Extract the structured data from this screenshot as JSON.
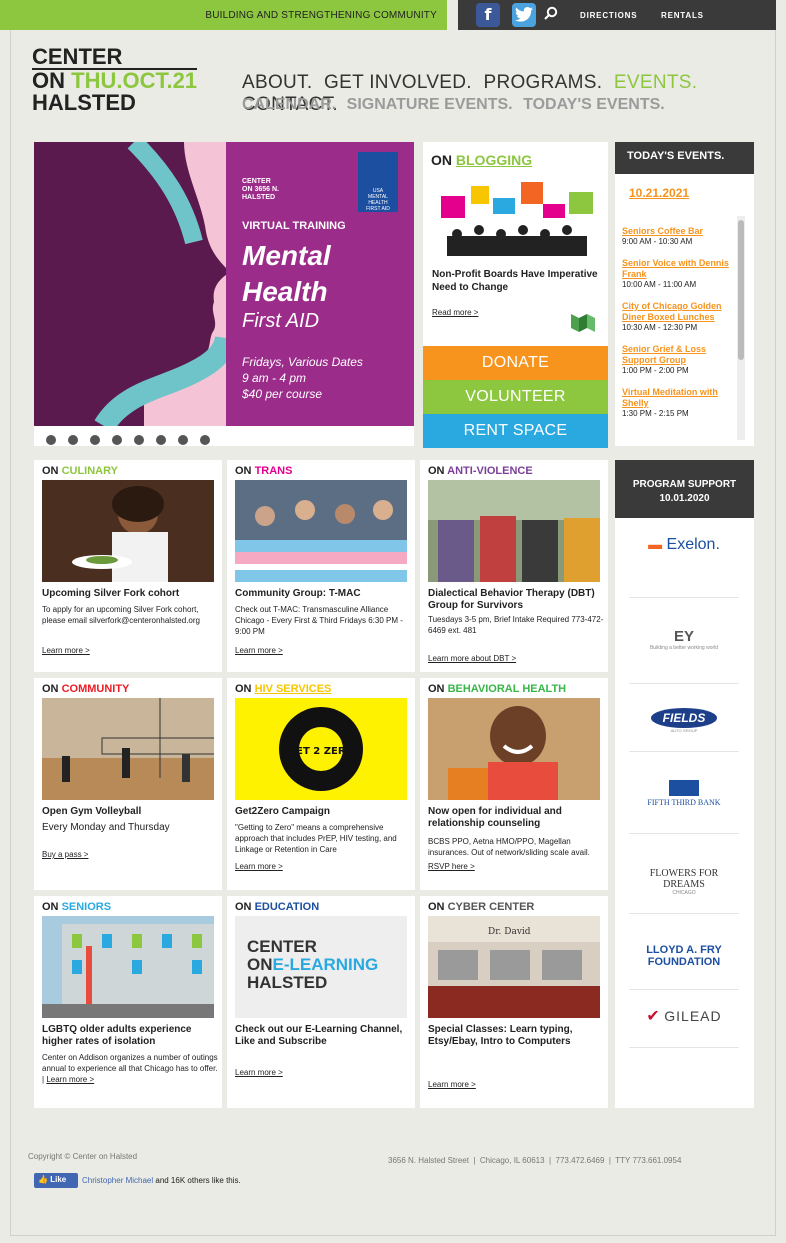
{
  "topbar": {
    "tagline": "BUILDING AND STRENGTHENING COMMUNITY",
    "facebook_icon": "f",
    "twitter_icon": "t",
    "directions": "DIRECTIONS",
    "rentals": "RENTALS"
  },
  "logo": {
    "line1": "CENTER",
    "line2_prefix": "ON ",
    "date": "THU.OCT.21",
    "line3": "HALSTED"
  },
  "nav": {
    "items": [
      "ABOUT.",
      "GET INVOLVED.",
      "PROGRAMS.",
      "EVENTS.",
      "CONTACT."
    ],
    "sub": [
      "CALENDAR.",
      "SIGNATURE EVENTS.",
      "TODAY'S EVENTS."
    ]
  },
  "hero": {
    "small": "CENTER\nON 3656 N.\nHALSTED",
    "training": "VIRTUAL TRAINING",
    "title1": "Mental",
    "title2": "Health",
    "title3": "First AID",
    "dates": "Fridays, Various Dates",
    "times": "9 am - 4 pm",
    "price": "$40 per course",
    "badge": "USA\nMENTAL\nHEALTH\nFIRST AID"
  },
  "blog": {
    "on": "ON ",
    "kw": "BLOGGING",
    "title": "Non-Profit Boards Have Imperative Need to Change",
    "more": "Read more >"
  },
  "cta": {
    "donate": "DONATE",
    "volunteer": "VOLUNTEER",
    "rent": "RENT SPACE"
  },
  "today": {
    "header": "TODAY'S EVENTS.",
    "date": "10.21.2021",
    "events": [
      {
        "title": "Seniors Coffee Bar",
        "time": "9:00 AM - 10:30 AM"
      },
      {
        "title": "Senior Voice with Dennis Frank",
        "time": "10:00 AM - 11:00 AM"
      },
      {
        "title": "City of Chicago Golden Diner Boxed Lunches",
        "time": "10:30 AM - 12:30 PM"
      },
      {
        "title": "Senior Grief & Loss Support Group",
        "time": "1:00 PM - 2:00 PM"
      },
      {
        "title": "Virtual Meditation with Shelly",
        "time": "1:30 PM - 2:15 PM"
      }
    ]
  },
  "cards": [
    {
      "on": "ON ",
      "kw": "CULINARY",
      "kwcolor": "#8dc63f",
      "title": "Upcoming Silver Fork cohort",
      "body": "To apply for an upcoming Silver Fork cohort, please email silverfork@centeronhalsted.org",
      "link": "Learn more >"
    },
    {
      "on": "ON ",
      "kw": "TRANS",
      "kwcolor": "#e4008c",
      "title": "Community Group: T-MAC",
      "body": "Check out T-MAC: Transmasculine Alliance Chicago - Every First & Third Fridays 6:30 PM - 9:00 PM",
      "link": "Learn more >"
    },
    {
      "on": "ON ",
      "kw": "ANTI-VIOLENCE",
      "kwcolor": "#7b3f98",
      "title": "Dialectical Behavior Therapy (DBT) Group for Survivors",
      "body": "Tuesdays 3-5 pm, Brief Intake Required 773-472-6469 ext. 481",
      "link": "Learn more about DBT >"
    },
    {
      "on": "ON ",
      "kw": "COMMUNITY",
      "kwcolor": "#ed1c24",
      "title": "Open Gym Volleyball",
      "body2": "Every Monday and Thursday",
      "link": "Buy a pass >"
    },
    {
      "on": "ON ",
      "kw": "HIV SERVICES",
      "kwcolor": "#f7c600",
      "title": "Get2Zero Campaign",
      "body": "\"Getting to Zero\" means a comprehensive approach that includes PrEP, HIV testing, and Linkage or Retention in Care",
      "link": "Learn more >",
      "art": "GET 2 ZERO"
    },
    {
      "on": "ON ",
      "kw": "BEHAVIORAL HEALTH",
      "kwcolor": "#39b54a",
      "title": "Now open for individual and relationship counseling",
      "body": "BCBS PPO, Aetna HMO/PPO, Magellan insurances. Out of network/sliding scale avail.",
      "link": "RSVP here >"
    },
    {
      "on": "ON ",
      "kw": "SENIORS",
      "kwcolor": "#29a9e0",
      "title": "LGBTQ older adults experience higher rates of isolation",
      "body": "Center on Addison organizes a number of outings annual to experience all that Chicago has to offer. |",
      "link": "Learn more >"
    },
    {
      "on": "ON ",
      "kw": "EDUCATION",
      "kwcolor": "#1d4fa0",
      "title": "Check out our E-Learning Channel, Like and Subscribe",
      "link": "Learn more >",
      "art1": "CENTER",
      "art2": "ON",
      "art3": "E-LEARNING",
      "art4": "HALSTED"
    },
    {
      "on": "ON ",
      "kw": "CYBER CENTER",
      "kwcolor": "#555555",
      "title": "Special Classes: Learn typing, Etsy/Ebay, Intro to Computers",
      "link": "Learn more >",
      "art": "Dr. David"
    }
  ],
  "sponsors": {
    "header": "PROGRAM SUPPORT\n10.01.2020",
    "items": [
      "Exelon.",
      "EY",
      "FIELDS",
      "FIFTH THIRD BANK",
      "FLOWERS FOR DREAMS",
      "LLOYD A. FRY\nFOUNDATION",
      "GILEAD"
    ],
    "ey_tag": "Building a better working world",
    "fields_tag": "AUTO GROUP",
    "flowers_tag": "CHICAGO"
  },
  "footer": {
    "copyright": "Copyright © Center on Halsted",
    "address": "3656 N. Halsted Street  |  Chicago, IL 60613  |  773.472.6469  |  TTY 773.661.0954",
    "like": "Like",
    "liker": "Christopher Michael",
    "like_rest": " and 16K others like this."
  }
}
